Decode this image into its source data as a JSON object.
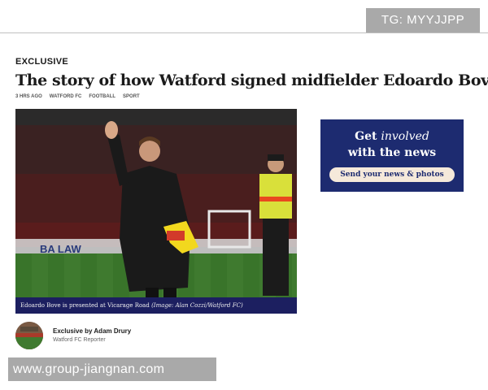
{
  "overlays": {
    "tg_watermark": "TG: MYYJJPP",
    "site_watermark": "www.group-jiangnan.com"
  },
  "article": {
    "kicker": "EXCLUSIVE",
    "headline": "The story of how Watford signed midfielder Edoardo Bove",
    "meta": [
      "3 HRS AGO",
      "WATFORD FC",
      "FOOTBALL",
      "SPORT"
    ],
    "image": {
      "ad_board_text": "BA LAW",
      "caption": "Edoardo Bove is presented at Vicarage Road",
      "caption_credit": "(Image: Alan Cozzi/Watford FC)"
    },
    "author": {
      "name": "Exclusive by Adam Drury",
      "role": "Watford FC Reporter"
    }
  },
  "promo": {
    "line1_prefix": "Get ",
    "line1_italic": "involved",
    "line2": "with the news",
    "button_label": "Send your news & photos"
  },
  "colors": {
    "brand_navy": "#1d2b70",
    "caption_bar": "#1c1f60",
    "button_cream": "#f5e9da",
    "watermark_grey": "#a9a9a9"
  }
}
